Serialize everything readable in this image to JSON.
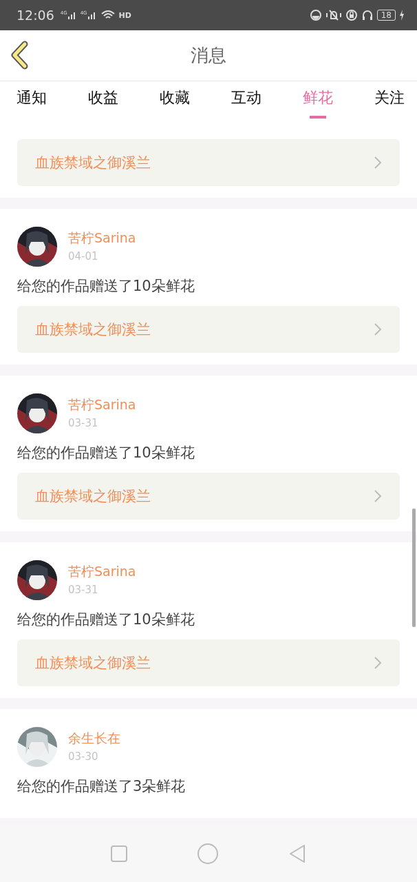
{
  "status_bar": {
    "time": "12:06",
    "networks": [
      "4G",
      "4G"
    ],
    "hd": "HD",
    "battery": "18"
  },
  "header": {
    "title": "消息"
  },
  "tabs": [
    {
      "label": "通知",
      "selected": false
    },
    {
      "label": "收益",
      "selected": false
    },
    {
      "label": "收藏",
      "selected": false
    },
    {
      "label": "互动",
      "selected": false
    },
    {
      "label": "鲜花",
      "selected": true
    },
    {
      "label": "关注",
      "selected": false
    }
  ],
  "messages": [
    {
      "book": "血族禁域之御溪兰"
    },
    {
      "user": "苦柠Sarina",
      "date": "04-01",
      "text": "给您的作品赠送了10朵鲜花",
      "book": "血族禁域之御溪兰"
    },
    {
      "user": "苦柠Sarina",
      "date": "03-31",
      "text": "给您的作品赠送了10朵鲜花",
      "book": "血族禁域之御溪兰"
    },
    {
      "user": "苦柠Sarina",
      "date": "03-31",
      "text": "给您的作品赠送了10朵鲜花",
      "book": "血族禁域之御溪兰"
    },
    {
      "user": "余生长在",
      "date": "03-30",
      "text": "给您的作品赠送了3朵鲜花"
    }
  ]
}
